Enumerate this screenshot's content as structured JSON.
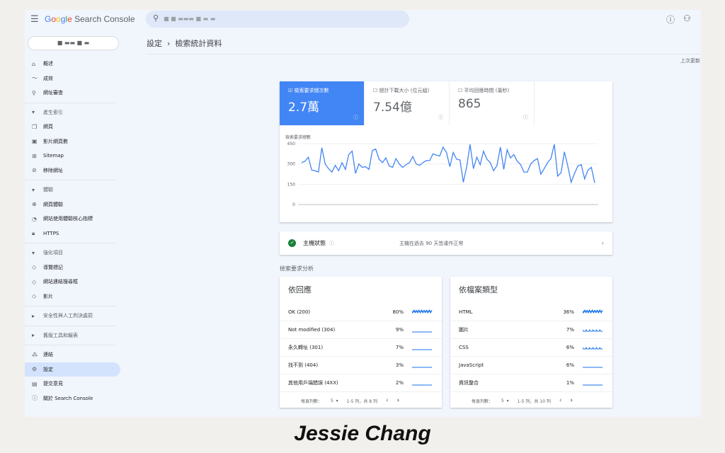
{
  "header": {
    "app_name": "Google Search Console",
    "search_placeholder": "■ ■      ▬▬▬ ■      ▬      ▬",
    "help_icon": "help-icon",
    "account_icon": "manage-accounts-icon"
  },
  "property": "■ ▬▬  ■ ▬",
  "sidebar": {
    "items": [
      {
        "label": "概述",
        "icon": "home-icon",
        "type": "item"
      },
      {
        "label": "成效",
        "icon": "trending-icon",
        "type": "item"
      },
      {
        "label": "網址審查",
        "icon": "search-icon",
        "type": "item"
      },
      {
        "label": "產生索引",
        "type": "section"
      },
      {
        "label": "網頁",
        "icon": "pages-icon",
        "type": "item"
      },
      {
        "label": "影片網頁數",
        "icon": "video-page-icon",
        "type": "item"
      },
      {
        "label": "Sitemap",
        "icon": "sitemap-icon",
        "type": "item"
      },
      {
        "label": "移除網址",
        "icon": "eye-off-icon",
        "type": "item"
      },
      {
        "label": "體驗",
        "type": "section"
      },
      {
        "label": "網頁體驗",
        "icon": "page-experience-icon",
        "type": "item"
      },
      {
        "label": "網站使用體驗核心指標",
        "icon": "gauge-icon",
        "type": "item"
      },
      {
        "label": "HTTPS",
        "icon": "lock-icon",
        "type": "item"
      },
      {
        "label": "強化項目",
        "type": "section"
      },
      {
        "label": "導覽標記",
        "icon": "layers-icon",
        "type": "item"
      },
      {
        "label": "網站連結搜尋框",
        "icon": "layers-icon",
        "type": "item"
      },
      {
        "label": "影片",
        "icon": "layers-icon",
        "type": "item"
      },
      {
        "label": "安全性與人工判決處罰",
        "type": "section-collapsed"
      },
      {
        "label": "舊版工具和報表",
        "type": "section-collapsed"
      },
      {
        "label": "連結",
        "icon": "links-icon",
        "type": "item"
      },
      {
        "label": "設定",
        "icon": "gear-icon",
        "type": "item",
        "active": true
      },
      {
        "label": "提交意見",
        "icon": "feedback-icon",
        "type": "item"
      },
      {
        "label": "關於 Search Console",
        "icon": "info-icon",
        "type": "item"
      }
    ]
  },
  "breadcrumb": {
    "parent": "設定",
    "current": "檢索統計資料"
  },
  "last_updated": "上次更新",
  "metrics": [
    {
      "label": "檢索要求總次數",
      "value": "2.7萬",
      "checked": true
    },
    {
      "label": "總計下載大小 (位元組)",
      "value": "7.54億",
      "checked": false
    },
    {
      "label": "平均回應時間 (毫秒)",
      "value": "865",
      "checked": false
    }
  ],
  "chart_data": {
    "type": "line",
    "ylabel": "檢索要求總數",
    "yticks": [
      0,
      150,
      300,
      450
    ],
    "ylim": [
      0,
      450
    ],
    "grid": true,
    "color": "#4285f4",
    "values": [
      310,
      320,
      350,
      255,
      250,
      240,
      420,
      300,
      265,
      240,
      290,
      250,
      310,
      260,
      370,
      395,
      230,
      300,
      275,
      280,
      260,
      400,
      410,
      335,
      310,
      345,
      285,
      275,
      340,
      300,
      275,
      295,
      310,
      355,
      300,
      290,
      310,
      325,
      325,
      375,
      365,
      360,
      425,
      385,
      280,
      385,
      335,
      330,
      165,
      280,
      445,
      265,
      350,
      295,
      395,
      335,
      310,
      250,
      290,
      425,
      260,
      405,
      345,
      370,
      320,
      295,
      240,
      240,
      300,
      325,
      340,
      225,
      265,
      310,
      340,
      445,
      210,
      235,
      390,
      285,
      165,
      230,
      285,
      295,
      190,
      255,
      275,
      160
    ]
  },
  "host_status": {
    "label": "主機狀態",
    "message": "主機在過去 90 天皆運作正常",
    "status_color": "#188038"
  },
  "section_title": "檢索要求分析",
  "by_response": {
    "title": "依回應",
    "rows": [
      {
        "name": "OK (200)",
        "pct": "80%"
      },
      {
        "name": "Not modified (304)",
        "pct": "9%"
      },
      {
        "name": "永久轉址 (301)",
        "pct": "7%"
      },
      {
        "name": "找不到 (404)",
        "pct": "3%"
      },
      {
        "name": "其他用戶端錯誤 (4XX)",
        "pct": "2%"
      }
    ],
    "rows_label": "每頁列數：",
    "rows_value": "5",
    "range": "1-5 列，共 8 列"
  },
  "by_filetype": {
    "title": "依檔案類型",
    "rows": [
      {
        "name": "HTML",
        "pct": "36%"
      },
      {
        "name": "圖片",
        "pct": "7%"
      },
      {
        "name": "CSS",
        "pct": "6%"
      },
      {
        "name": "JavaScript",
        "pct": "6%"
      },
      {
        "name": "資訊整合",
        "pct": "1%"
      }
    ],
    "rows_label": "每頁列數：",
    "rows_value": "5",
    "range": "1-5 列，共 10 列"
  },
  "signature": "Jessie Chang"
}
